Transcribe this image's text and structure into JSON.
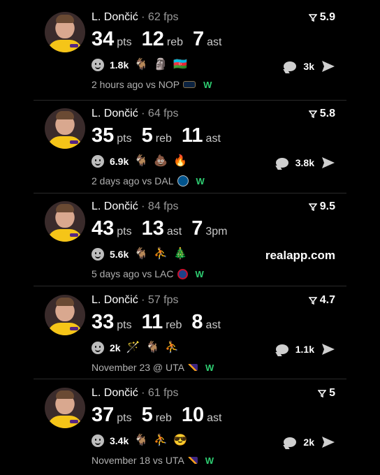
{
  "colors": {
    "background": "#000000",
    "win": "#2ecc71",
    "lakers_gold": "#f5c518",
    "lakers_purple": "#552583"
  },
  "posts": [
    {
      "player": "L. Dončić",
      "fps": "· 62 fps",
      "score": "5.9",
      "stats": [
        {
          "value": "34",
          "unit": "pts"
        },
        {
          "value": "12",
          "unit": "reb"
        },
        {
          "value": "7",
          "unit": "ast"
        }
      ],
      "reaction_count": "1.8k",
      "reaction_icons": [
        "goat-icon",
        "statue-icon",
        "azerbaijan-flag-icon"
      ],
      "comments": "3k",
      "time": "2 hours ago vs NOP",
      "opponent_icon": "pelicans-logo-icon",
      "result": "W"
    },
    {
      "player": "L. Dončić",
      "fps": "· 64 fps",
      "score": "5.8",
      "stats": [
        {
          "value": "35",
          "unit": "pts"
        },
        {
          "value": "5",
          "unit": "reb"
        },
        {
          "value": "11",
          "unit": "ast"
        }
      ],
      "reaction_count": "6.9k",
      "reaction_icons": [
        "goat-icon",
        "poop-icon",
        "fire-icon"
      ],
      "comments": "3.8k",
      "time": "2 days ago vs DAL",
      "opponent_icon": "mavericks-logo-icon",
      "result": "W"
    },
    {
      "player": "L. Dončić",
      "fps": "· 84 fps",
      "score": "9.5",
      "stats": [
        {
          "value": "43",
          "unit": "pts"
        },
        {
          "value": "13",
          "unit": "ast"
        },
        {
          "value": "7",
          "unit": "3pm"
        }
      ],
      "reaction_count": "5.6k",
      "reaction_icons": [
        "goat-icon",
        "player-icon",
        "christmas-tree-icon"
      ],
      "promo": "realapp.com",
      "time": "5 days ago vs LAC",
      "opponent_icon": "clippers-logo-icon",
      "result": "W"
    },
    {
      "player": "L. Dončić",
      "fps": "· 57 fps",
      "score": "4.7",
      "stats": [
        {
          "value": "33",
          "unit": "pts"
        },
        {
          "value": "11",
          "unit": "reb"
        },
        {
          "value": "8",
          "unit": "ast"
        }
      ],
      "reaction_count": "2k",
      "reaction_icons": [
        "magic-wand-icon",
        "goat-icon",
        "player-icon"
      ],
      "comments": "1.1k",
      "time": "November 23 @ UTA",
      "opponent_icon": "jazz-logo-icon",
      "result": "W"
    },
    {
      "player": "L. Dončić",
      "fps": "· 61 fps",
      "score": "5",
      "stats": [
        {
          "value": "37",
          "unit": "pts"
        },
        {
          "value": "5",
          "unit": "reb"
        },
        {
          "value": "10",
          "unit": "ast"
        }
      ],
      "reaction_count": "3.4k",
      "reaction_icons": [
        "goat-icon",
        "player-icon",
        "sunglasses-face-icon"
      ],
      "comments": "2k",
      "time": "November 18 vs UTA",
      "opponent_icon": "jazz-logo-icon",
      "result": "W"
    }
  ]
}
